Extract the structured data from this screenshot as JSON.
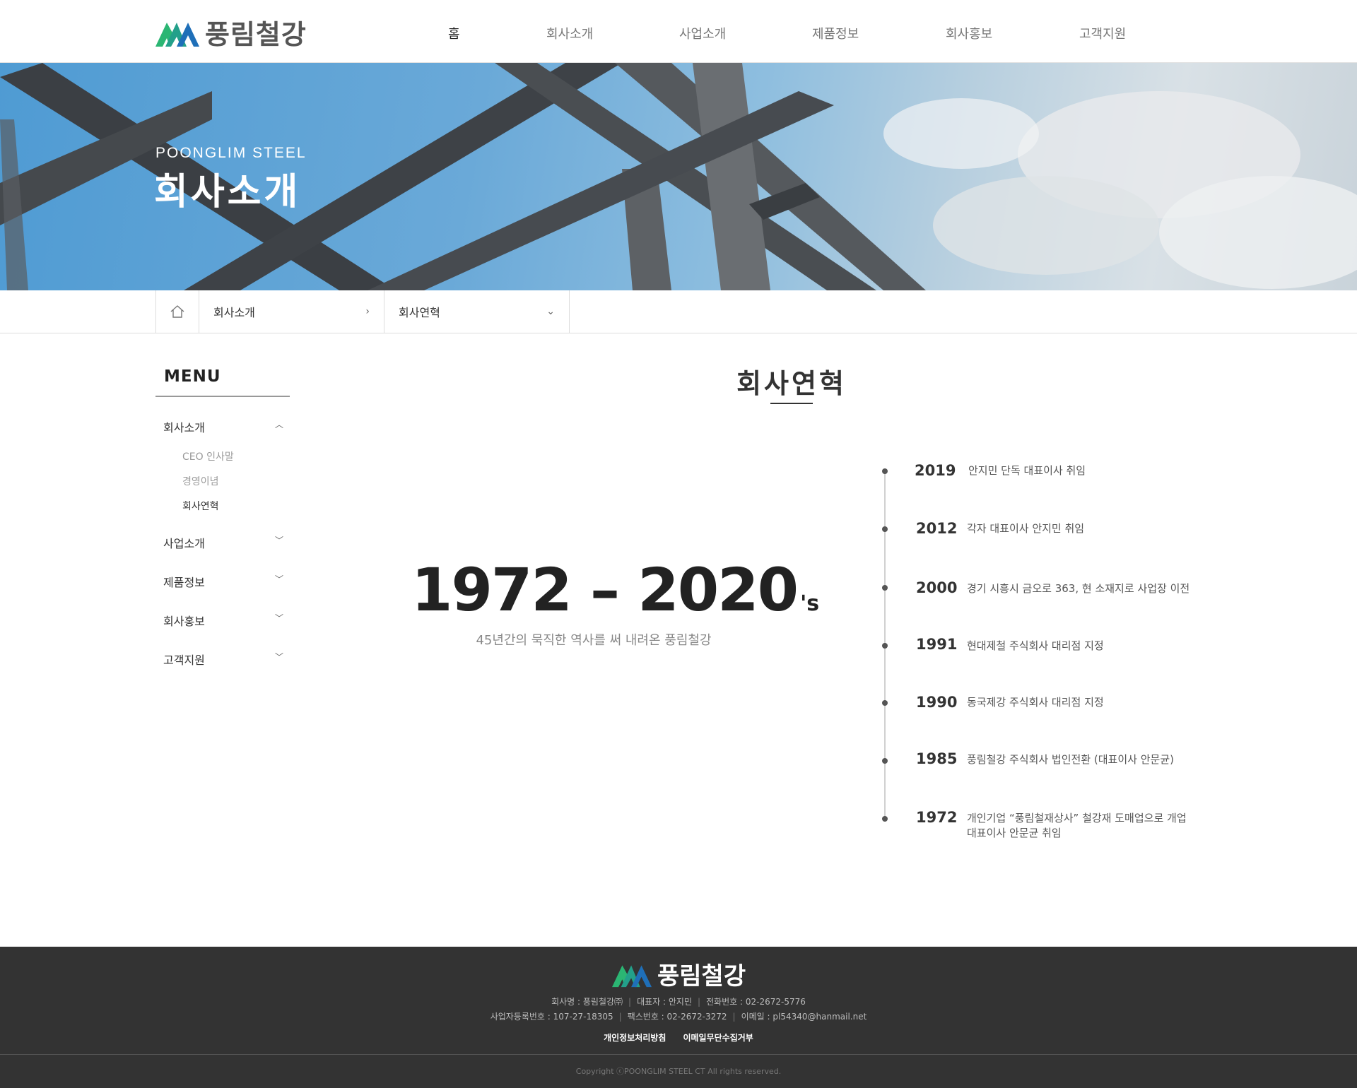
{
  "brand": {
    "name": "풍림철강"
  },
  "nav": [
    "홈",
    "회사소개",
    "사업소개",
    "제품정보",
    "회사홍보",
    "고객지원"
  ],
  "hero": {
    "subtitle": "POONGLIM STEEL",
    "title": "회사소개"
  },
  "breadcrumb": {
    "level1": "회사소개",
    "level2": "회사연혁"
  },
  "sidebar": {
    "title": "MENU",
    "items": [
      {
        "label": "회사소개",
        "expanded": true,
        "sub": [
          "CEO 인사말",
          "경영이념",
          "회사연혁"
        ],
        "current": "회사연혁"
      },
      {
        "label": "사업소개"
      },
      {
        "label": "제품정보"
      },
      {
        "label": "회사홍보"
      },
      {
        "label": "고객지원"
      }
    ]
  },
  "content": {
    "title": "회사연혁",
    "range": "1972 – 2020",
    "suffix": "'s",
    "caption": "45년간의 묵직한 역사를 써 내려온 풍림철강"
  },
  "timeline": [
    {
      "year": "2019",
      "text": "안지민 단독 대표이사 취임"
    },
    {
      "year": "2012",
      "text": "각자 대표이사 안지민 취임"
    },
    {
      "year": "2000",
      "text": "경기 시흥시 금오로 363, 현 소재지로 사업장 이전"
    },
    {
      "year": "1991",
      "text": "현대제철 주식회사 대리점 지정"
    },
    {
      "year": "1990",
      "text": "동국제강 주식회사 대리점 지정"
    },
    {
      "year": "1985",
      "text": "풍림철강 주식회사 법인전환 (대표이사 안문균)"
    },
    {
      "year": "1972",
      "text": "개인기업 “풍림철재상사” 철강재 도매업으로 개업",
      "text2": "대표이사 안문균 취임"
    }
  ],
  "footer": {
    "company": "회사명 : 풍림철강㈜",
    "ceo": "대표자 : 안지민",
    "phone": "전화번호 : 02-2672-5776",
    "bizno": "사업자등록번호 : 107-27-18305",
    "fax": "팩스번호 : 02-2672-3272",
    "email": "이메일 : pl54340@hanmail.net",
    "link_privacy": "개인정보처리방침",
    "link_email": "이메일무단수집거부",
    "copyright": "Copyright ⓒPOONGLIM STEEL CT All rights reserved."
  },
  "colors": {
    "logo_green": "#2bb673",
    "logo_blue": "#1f6fb8",
    "footer_bg": "#333333"
  }
}
